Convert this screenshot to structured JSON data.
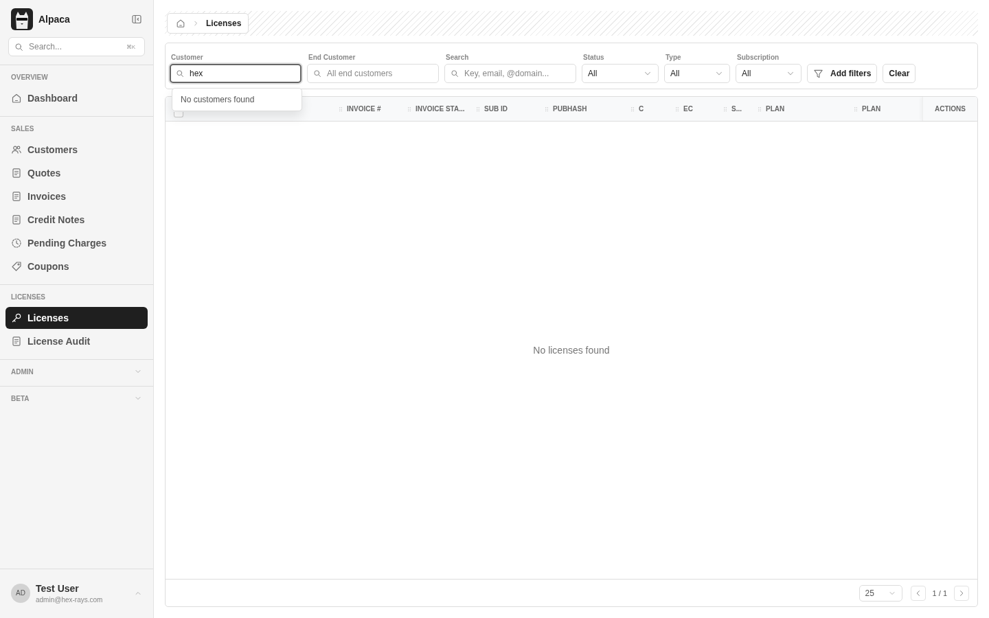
{
  "app": {
    "name": "Alpaca",
    "search_placeholder": "Search...",
    "shortcut": "⌘K"
  },
  "sidebar": {
    "sections": [
      {
        "title": "OVERVIEW",
        "kind": "static",
        "items": [
          {
            "label": "Dashboard",
            "selected": false
          }
        ]
      },
      {
        "title": "SALES",
        "kind": "static",
        "items": [
          {
            "label": "Customers",
            "selected": false
          },
          {
            "label": "Quotes",
            "selected": false
          },
          {
            "label": "Invoices",
            "selected": false
          },
          {
            "label": "Credit Notes",
            "selected": false
          },
          {
            "label": "Pending Charges",
            "selected": false
          },
          {
            "label": "Coupons",
            "selected": false
          }
        ]
      },
      {
        "title": "LICENSES",
        "kind": "static",
        "items": [
          {
            "label": "Licenses",
            "selected": true
          },
          {
            "label": "License Audit",
            "selected": false
          }
        ]
      },
      {
        "title": "ADMIN",
        "kind": "collapsible"
      },
      {
        "title": "BETA",
        "kind": "collapsible"
      }
    ]
  },
  "user": {
    "initials": "AD",
    "name": "Test User",
    "email": "admin@hex-rays.com"
  },
  "breadcrumb": {
    "current": "Licenses"
  },
  "filters": [
    {
      "kind": "search",
      "label": "Customer",
      "value": "hex",
      "focused": true
    },
    {
      "kind": "search",
      "label": "End Customer",
      "placeholder": "All end customers",
      "focused": false
    },
    {
      "kind": "search",
      "label": "Search",
      "placeholder": "Key, email, @domain...",
      "focused": false
    },
    {
      "kind": "select",
      "label": "Status",
      "value": "All"
    },
    {
      "kind": "select",
      "label": "Type",
      "value": "All"
    },
    {
      "kind": "select",
      "label": "Subscription",
      "value": "All"
    }
  ],
  "filter_buttons": [
    {
      "kind": "filter",
      "label": "Add filters"
    },
    {
      "kind": "plain",
      "label": "Clear"
    }
  ],
  "customer_popup": {
    "message": "No customers found"
  },
  "table": {
    "header_checkbox": {
      "checked": false
    },
    "columns": [
      {},
      {},
      {
        "label": "INVOICE #"
      },
      {
        "label": "INVOICE STA..."
      },
      {
        "label": "SUB ID"
      },
      {
        "label": "PUBHASH"
      },
      {
        "label": "C"
      },
      {
        "label": "EC"
      },
      {
        "label": "S..."
      },
      {
        "label": "PLAN"
      },
      {
        "label": "PLAN"
      }
    ],
    "actions_label": "ACTIONS",
    "empty_message": "No licenses found"
  },
  "pagination": {
    "page_size": "25",
    "page": "1 / 1"
  }
}
